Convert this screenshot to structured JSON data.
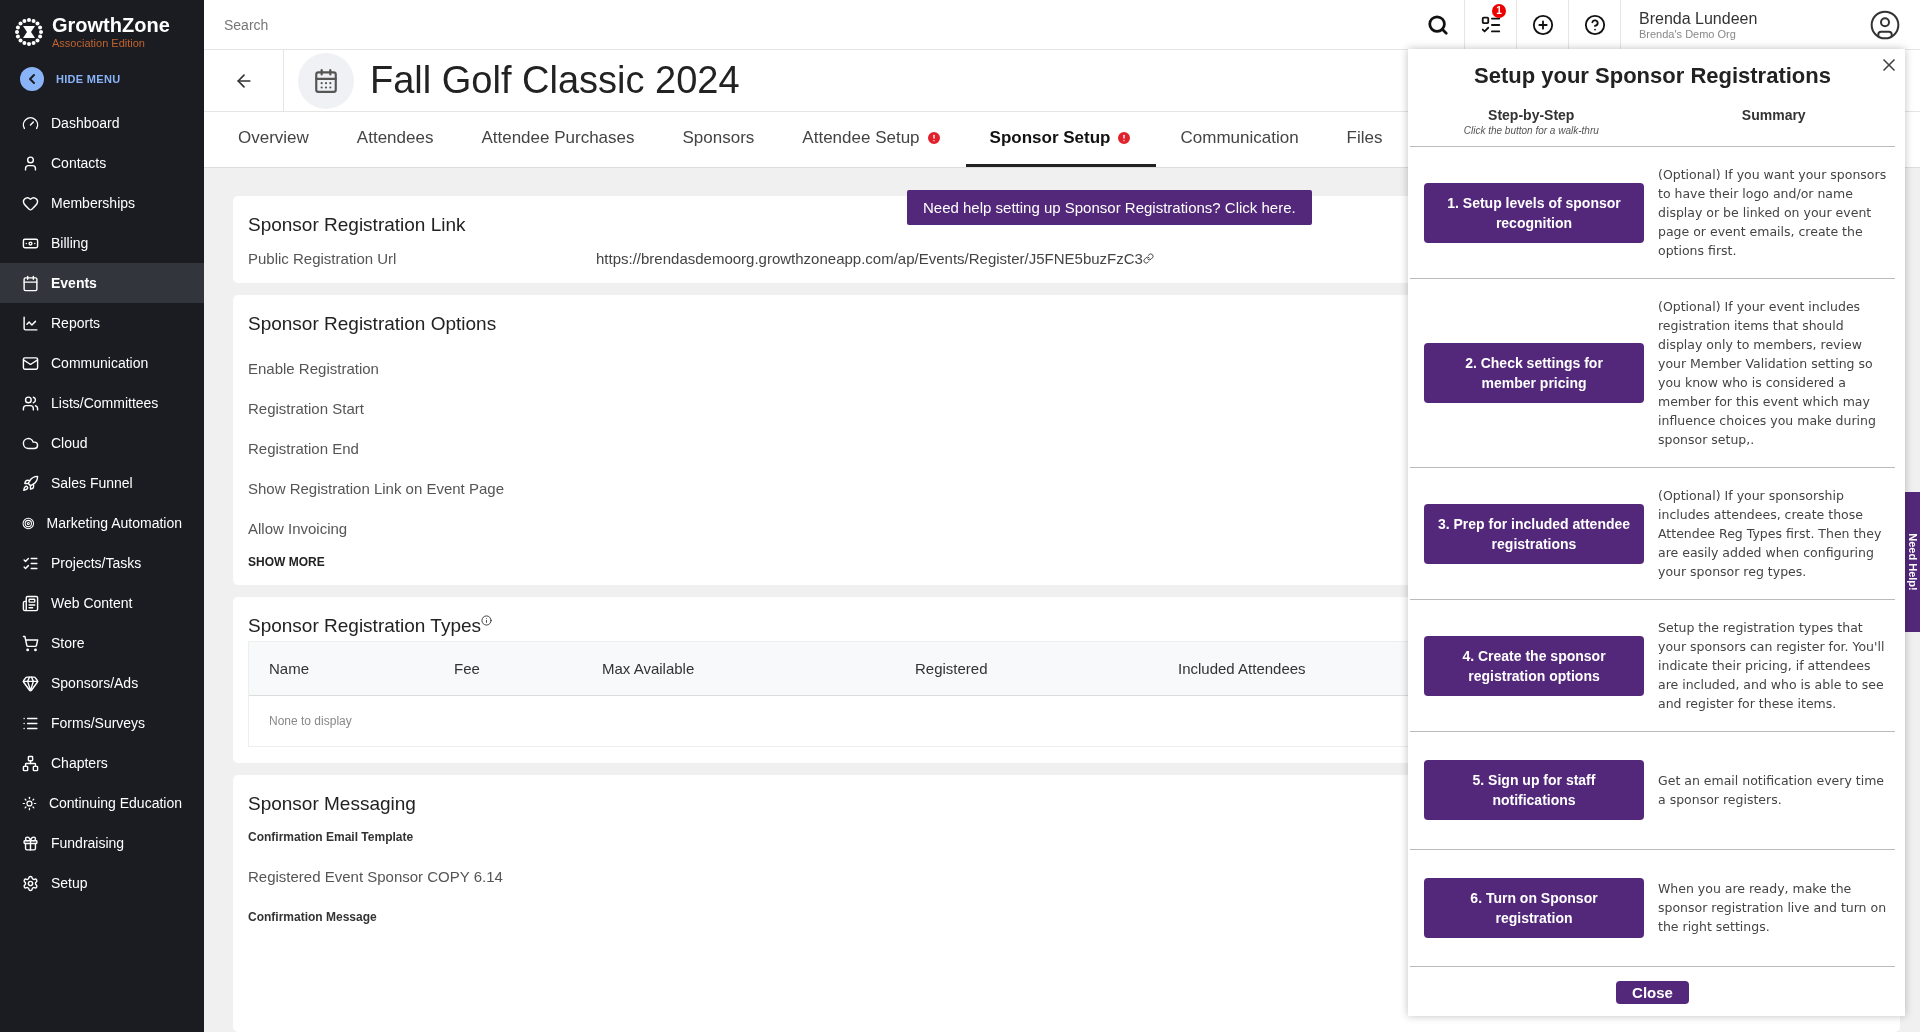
{
  "app": {
    "logo": "GrowthZone",
    "edition": "Association Edition",
    "hide_menu": "HIDE MENU"
  },
  "sidebar": {
    "items": [
      {
        "label": "Dashboard",
        "kind": "dashboard",
        "selected": false
      },
      {
        "label": "Contacts",
        "kind": "contacts",
        "selected": false
      },
      {
        "label": "Memberships",
        "kind": "memberships",
        "selected": false
      },
      {
        "label": "Billing",
        "kind": "billing",
        "selected": false
      },
      {
        "label": "Events",
        "kind": "events",
        "selected": true
      },
      {
        "label": "Reports",
        "kind": "reports",
        "selected": false
      },
      {
        "label": "Communication",
        "kind": "communication",
        "selected": false
      },
      {
        "label": "Lists/Committees",
        "kind": "lists",
        "selected": false
      },
      {
        "label": "Cloud",
        "kind": "cloud",
        "selected": false
      },
      {
        "label": "Sales Funnel",
        "kind": "sales",
        "selected": false
      },
      {
        "label": "Marketing Automation",
        "kind": "marketing",
        "selected": false
      },
      {
        "label": "Projects/Tasks",
        "kind": "projects",
        "selected": false
      },
      {
        "label": "Web Content",
        "kind": "web",
        "selected": false
      },
      {
        "label": "Store",
        "kind": "store",
        "selected": false
      },
      {
        "label": "Sponsors/Ads",
        "kind": "sponsors",
        "selected": false
      },
      {
        "label": "Forms/Surveys",
        "kind": "forms",
        "selected": false
      },
      {
        "label": "Chapters",
        "kind": "chapters",
        "selected": false
      },
      {
        "label": "Continuing Education",
        "kind": "education",
        "selected": false
      },
      {
        "label": "Fundraising",
        "kind": "fundraising",
        "selected": false
      },
      {
        "label": "Setup",
        "kind": "setup",
        "selected": false
      }
    ]
  },
  "topbar": {
    "search_placeholder": "Search",
    "task_badge": "1",
    "user_name": "Brenda Lundeen",
    "org": "Brenda's Demo Org"
  },
  "event": {
    "title": "Fall Golf Classic 2024"
  },
  "tabs": [
    {
      "label": "Overview",
      "alert": false,
      "selected": false
    },
    {
      "label": "Attendees",
      "alert": false,
      "selected": false
    },
    {
      "label": "Attendee Purchases",
      "alert": false,
      "selected": false
    },
    {
      "label": "Sponsors",
      "alert": false,
      "selected": false
    },
    {
      "label": "Attendee Setup",
      "alert": true,
      "selected": false
    },
    {
      "label": "Sponsor Setup",
      "alert": true,
      "selected": true
    },
    {
      "label": "Communication",
      "alert": false,
      "selected": false
    },
    {
      "label": "Files",
      "alert": false,
      "selected": false
    }
  ],
  "help_banner": "Need help setting up Sponsor Registrations? Click here.",
  "link_card": {
    "title": "Sponsor Registration Link",
    "label": "Public Registration Url",
    "url": "https://brendasdemoorg.growthzoneapp.com/ap/Events/Register/J5FNE5buzFzC3"
  },
  "options_card": {
    "title": "Sponsor Registration Options",
    "fields": [
      "Enable Registration",
      "Registration Start",
      "Registration End",
      "Show Registration Link on Event Page",
      "Allow Invoicing"
    ],
    "show_more": "SHOW MORE"
  },
  "types_card": {
    "title": "Sponsor Registration Types",
    "columns": [
      "Name",
      "Fee",
      "Max Available",
      "Registered",
      "Included Attendees"
    ],
    "empty": "None to display"
  },
  "messaging_card": {
    "title": "Sponsor Messaging",
    "items": [
      {
        "kind": "label",
        "text": "Confirmation Email Template"
      },
      {
        "kind": "value",
        "text": "Registered Event Sponsor COPY 6.14"
      },
      {
        "kind": "label",
        "text": "Confirmation Message"
      }
    ]
  },
  "panel": {
    "title": "Setup your Sponsor Registrations",
    "col1": "Step-by-Step",
    "col1_hint": "Click the button for a walk-thru",
    "col2": "Summary",
    "steps": [
      {
        "button": "1. Setup levels of sponsor recognition",
        "summary": "(Optional) If you want your sponsors to have their logo and/or name display or be linked on your event page or event emails, create the options first."
      },
      {
        "button": "2. Check settings for member pricing",
        "summary": "(Optional) If your event includes registration items that should display only to members, review your Member Validation setting so you know who is considered a member for this event which may influence choices you make during sponsor setup,."
      },
      {
        "button": "3. Prep for included attendee registrations",
        "summary": "(Optional) If your sponsorship includes attendees, create those Attendee Reg Types first. Then they are easily added when configuring your sponsor reg types."
      },
      {
        "button": "4. Create the sponsor registration options",
        "summary": "Setup the registration types that your sponsors can register for. You'll indicate their pricing, if attendees are included, and who is able to see and register for these items."
      },
      {
        "button": "5. Sign up for staff notifications",
        "summary": "Get an email notification every time a sponsor registers."
      },
      {
        "button": "6. Turn on Sponsor registration",
        "summary": "When you are ready, make the sponsor registration live and turn on the right settings."
      }
    ],
    "close": "Close"
  },
  "help_tab": "Need Help!"
}
